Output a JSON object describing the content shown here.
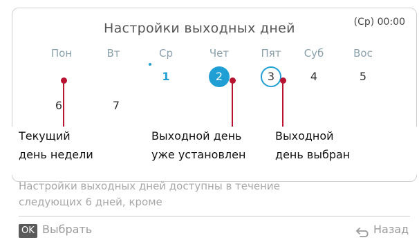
{
  "screen": {
    "title": "Настройки выходных дней",
    "clock": "(Ср) 00:00"
  },
  "week": {
    "days": [
      {
        "label": "Пон",
        "num": "6",
        "state": "normal"
      },
      {
        "label": "Вт",
        "num": "7",
        "state": "normal"
      },
      {
        "label": "Ср",
        "num": "1",
        "state": "today"
      },
      {
        "label": "Чет",
        "num": "2",
        "state": "holiday-set"
      },
      {
        "label": "Пят",
        "num": "3",
        "state": "holiday-selected"
      },
      {
        "label": "Суб",
        "num": "4",
        "state": "normal"
      },
      {
        "label": "Вос",
        "num": "5",
        "state": "normal"
      }
    ]
  },
  "callouts": {
    "current_day": {
      "line1": "Текущий",
      "line2": "день недели"
    },
    "holiday_set": {
      "line1": "Выходной день",
      "line2": "уже установлен"
    },
    "holiday_selected": {
      "line1": "Выходной",
      "line2": "день выбран"
    }
  },
  "info_text": {
    "line1": "Настройки выходных дней доступны в течение",
    "line2": "следующих 6 дней, кроме"
  },
  "footer": {
    "ok_badge": "OK",
    "select_label": "Выбрать",
    "back_label": "Назад",
    "back_icon": "return-arrow-icon"
  },
  "colors": {
    "accent": "#1f9fd4",
    "pointer": "#b81330",
    "hint_text": "#a8a8a8"
  }
}
